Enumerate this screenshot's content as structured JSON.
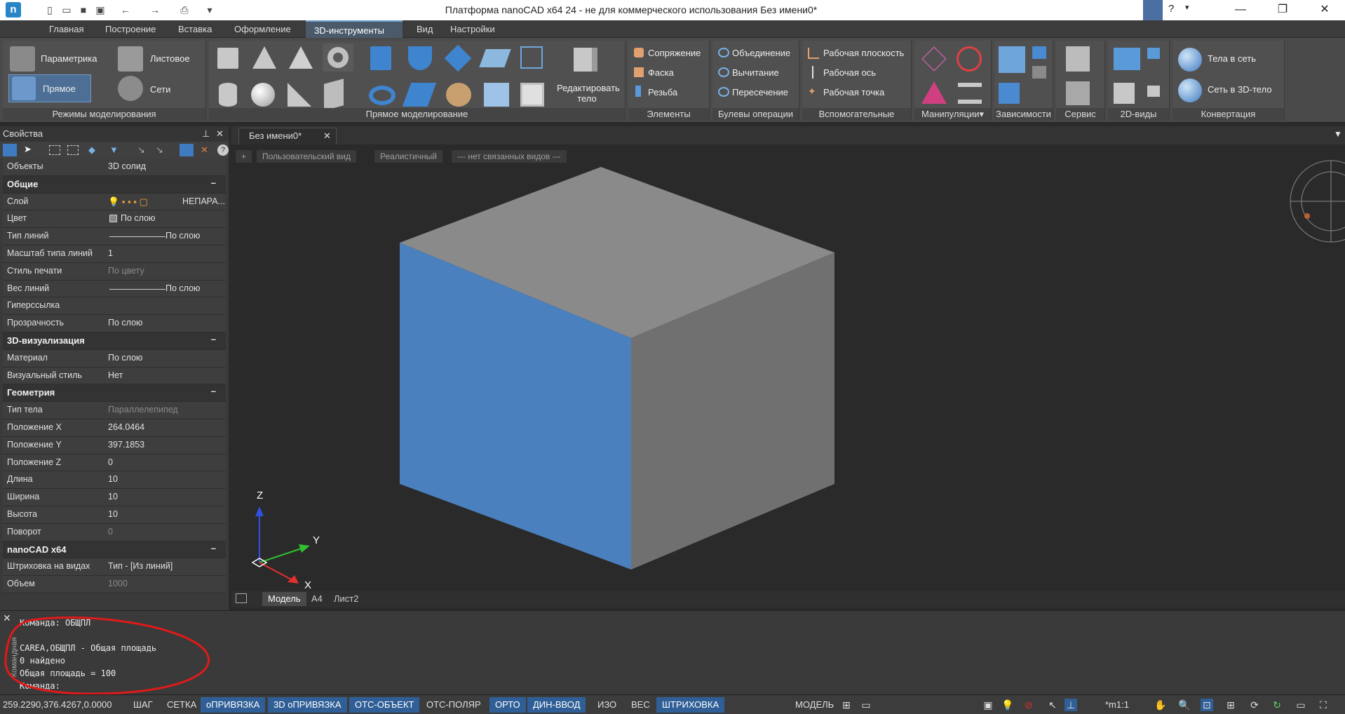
{
  "titlebar": {
    "title": "Платформа nanoCAD x64 24 - не для коммерческого использования Без имени0*",
    "logo_icon": "nanocad-logo-icon",
    "quick_access_icons": [
      "new-file-icon",
      "open-folder-icon",
      "save-icon",
      "save-all-icon",
      "undo-icon",
      "redo-icon",
      "print-icon",
      "dropdown-icon"
    ],
    "help": "?"
  },
  "menu": [
    "Главная",
    "Построение",
    "Вставка",
    "Оформление",
    "3D-инструменты",
    "Вид",
    "Настройки"
  ],
  "menu_active_index": 4,
  "ribbon": {
    "groups": {
      "modes": {
        "label": "Режимы моделирования",
        "items": [
          "Параметрика",
          "Листовое",
          "Прямое",
          "Сети"
        ]
      },
      "direct": {
        "label": "Прямое моделирование",
        "edit_body": "Редактировать тело"
      },
      "elements": {
        "label": "Элементы",
        "items": [
          "Сопряжение",
          "Фаска",
          "Резьба"
        ]
      },
      "boolean": {
        "label": "Булевы операции",
        "items": [
          "Объединение",
          "Вычитание",
          "Пересечение"
        ]
      },
      "aux": {
        "label": "Вспомогательные",
        "items": [
          "Рабочая плоскость",
          "Рабочая ось",
          "Рабочая точка"
        ]
      },
      "manip": {
        "label": "Манипуляции▾"
      },
      "deps": {
        "label": "Зависимости"
      },
      "service": {
        "label": "Сервис"
      },
      "views2d": {
        "label": "2D-виды"
      },
      "convert": {
        "label": "Конвертация",
        "items": [
          "Тела в сеть",
          "Сеть в 3D-тело"
        ]
      }
    }
  },
  "properties": {
    "title": "Свойства",
    "object_key": "Объекты",
    "object_value": "3D солид",
    "cat_general": "Общие",
    "general": [
      {
        "k": "Слой",
        "v": "НЕПАРА..."
      },
      {
        "k": "Цвет",
        "v": "По слою"
      },
      {
        "k": "Тип линий",
        "v": "По слою"
      },
      {
        "k": "Масштаб типа линий",
        "v": "1"
      },
      {
        "k": "Стиль печати",
        "v": "По цвету"
      },
      {
        "k": "Вес линий",
        "v": "По слою"
      },
      {
        "k": "Гиперссылка",
        "v": ""
      },
      {
        "k": "Прозрачность",
        "v": "По слою"
      }
    ],
    "cat_vis": "3D-визуализация",
    "vis": [
      {
        "k": "Материал",
        "v": "По слою"
      },
      {
        "k": "Визуальный стиль",
        "v": "Нет"
      }
    ],
    "cat_geom": "Геометрия",
    "geom": [
      {
        "k": "Тип тела",
        "v": "Параллелепипед"
      },
      {
        "k": "Положение X",
        "v": "264.0464"
      },
      {
        "k": "Положение Y",
        "v": "397.1853"
      },
      {
        "k": "Положение Z",
        "v": "0"
      },
      {
        "k": "Длина",
        "v": "10"
      },
      {
        "k": "Ширина",
        "v": "10"
      },
      {
        "k": "Высота",
        "v": "10"
      },
      {
        "k": "Поворот",
        "v": "0"
      }
    ],
    "cat_nano": "nanoCAD x64",
    "nano": [
      {
        "k": "Штриховка на видах",
        "v": "Тип - [Из линий]"
      },
      {
        "k": "Объем",
        "v": "1000"
      }
    ],
    "minus": "–"
  },
  "doc_tab": "Без имени0*",
  "viewport": {
    "tags": [
      "+",
      "Пользовательский вид",
      "Реалистичный",
      "--- нет связанных видов ---"
    ],
    "axes": {
      "z": "Z",
      "y": "Y",
      "x": "X"
    },
    "colors": {
      "cube_top": "#8a8a8a",
      "cube_left": "#4a80bd",
      "cube_right": "#707070"
    }
  },
  "layout_tabs": [
    "Модель",
    "A4",
    "Лист2"
  ],
  "command": {
    "lines": [
      "Команда: ОБЩПЛ",
      "",
      "CAREA,ОБЩПЛ - Общая площадь",
      "0 найдено",
      "Общая площадь = 100",
      "Команда:"
    ],
    "side_label": "Командная"
  },
  "status": {
    "coords": "259.2290,376.4267,0.0000",
    "toggles": [
      {
        "label": "ШАГ",
        "on": false
      },
      {
        "label": "СЕТКА",
        "on": false
      },
      {
        "label": "оПРИВЯЗКА",
        "on": true
      },
      {
        "label": "3D оПРИВЯЗКА",
        "on": true
      },
      {
        "label": "ОТС-ОБЪЕКТ",
        "on": true
      },
      {
        "label": "ОТС-ПОЛЯР",
        "on": false
      },
      {
        "label": "ОРТО",
        "on": true
      },
      {
        "label": "ДИН-ВВОД",
        "on": true
      },
      {
        "label": "ИЗО",
        "on": false
      },
      {
        "label": "ВЕС",
        "on": false
      },
      {
        "label": "ШТРИХОВКА",
        "on": true
      }
    ],
    "model": "МОДЕЛЬ",
    "scale": "*m1:1"
  }
}
